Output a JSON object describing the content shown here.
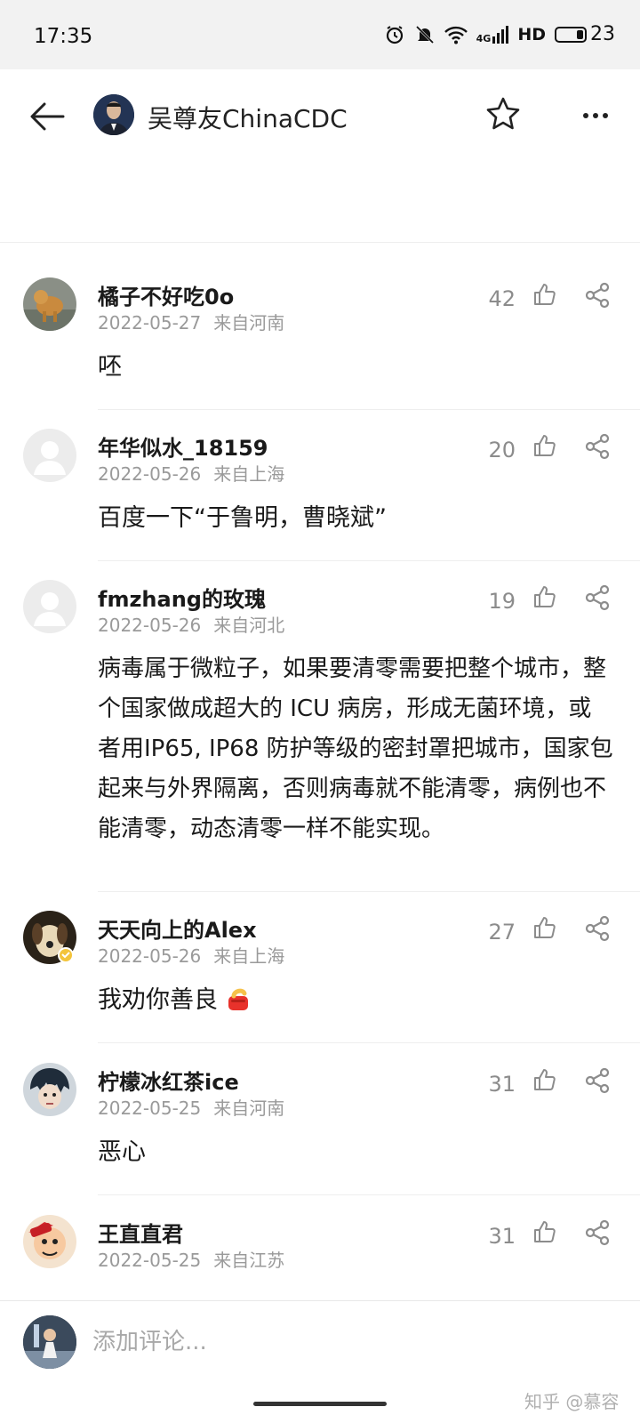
{
  "status_bar": {
    "time": "17:35",
    "network": "4G",
    "hd": "HD",
    "battery": "23",
    "battery_level": 0.23,
    "icons": [
      "alarm-icon",
      "mute-icon",
      "wifi-icon",
      "signal-icon",
      "battery-icon"
    ]
  },
  "header": {
    "title": "吴尊友ChinaCDC",
    "icons": [
      "back-arrow-icon",
      "star-icon",
      "more-icon"
    ]
  },
  "comments": [
    {
      "user": "橘子不好吃0o",
      "date": "2022-05-27",
      "location": "来自河南",
      "likes": "42",
      "text": "呸"
    },
    {
      "user": "年华似水_18159",
      "date": "2022-05-26",
      "location": "来自上海",
      "likes": "20",
      "text": "百度一下“于鲁明，曹晓斌”"
    },
    {
      "user": "fmzhang的玫瑰",
      "date": "2022-05-26",
      "location": "来自河北",
      "likes": "19",
      "text": "病毒属于微粒子，如果要清零需要把整个城市，整个国家做成超大的 ICU 病房，形成无菌环境，或者用IP65, IP68 防护等级的密封罩把城市，国家包起来与外界隔离，否则病毒就不能清零，病例也不能清零，动态清零一样不能实现。"
    },
    {
      "user": "天天向上的Alex",
      "date": "2022-05-26",
      "location": "来自上海",
      "likes": "27",
      "text": "我劝你善良"
    },
    {
      "user": "柠檬冰红茶ice",
      "date": "2022-05-25",
      "location": "来自河南",
      "likes": "31",
      "text": "恶心"
    },
    {
      "user": "王直直君",
      "date": "2022-05-25",
      "location": "来自江苏",
      "likes": "31",
      "text": ""
    }
  ],
  "footer": {
    "placeholder": "添加评论..."
  },
  "watermark": "知乎 @慕容"
}
